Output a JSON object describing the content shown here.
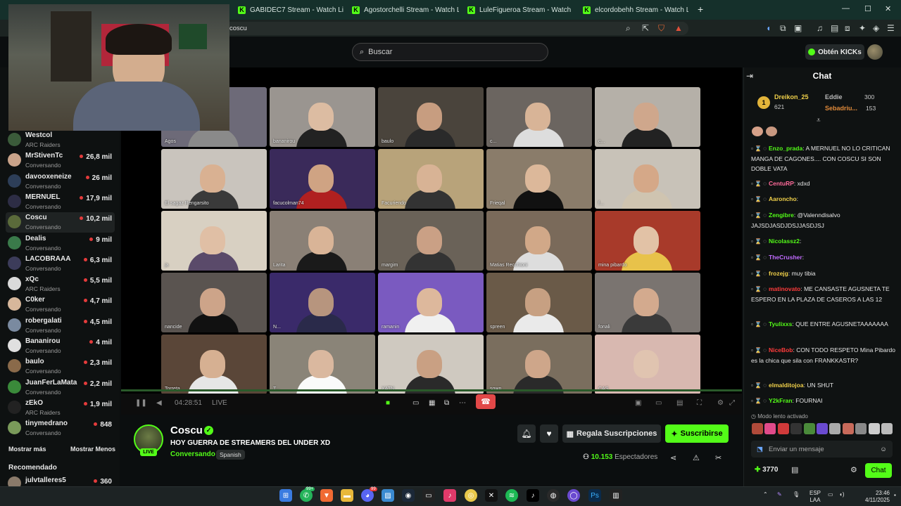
{
  "browser": {
    "tabs": [
      {
        "label": "GABIDEC7 Stream - Watch Live on Ki"
      },
      {
        "label": "Agostorchelli Stream - Watch Live on"
      },
      {
        "label": "LuleFigueroa Stream - Watch Live on"
      },
      {
        "label": "elcordobehh Stream - Watch Live on"
      }
    ],
    "new_tab": "+",
    "address": "coscu",
    "window_controls": {
      "minimize": "—",
      "maximize": "☐",
      "close": "✕"
    }
  },
  "header": {
    "search_placeholder": "Buscar",
    "kicks_button": "Obtén KICKs"
  },
  "sidebar": {
    "channels": [
      {
        "name": "Westcol",
        "status": "ARC Raiders",
        "viewers": "",
        "color": "#3b5b3a"
      },
      {
        "name": "MrStivenTc",
        "status": "Conversando",
        "viewers": "26,8 mil",
        "color": "#c9a38a"
      },
      {
        "name": "davooxeneize",
        "status": "Conversando",
        "viewers": "26 mil",
        "color": "#2d3e58"
      },
      {
        "name": "MERNUEL",
        "status": "Conversando",
        "viewers": "17,9 mil",
        "color": "#2d2d45"
      },
      {
        "name": "Coscu",
        "status": "Conversando",
        "viewers": "10,2 mil",
        "color": "#5a6a3a"
      },
      {
        "name": "Dealis",
        "status": "Conversando",
        "viewers": "9 mil",
        "color": "#3a7a4a"
      },
      {
        "name": "LACOBRAAA",
        "status": "Conversando",
        "viewers": "6,3 mil",
        "color": "#3c3c5a"
      },
      {
        "name": "xQc",
        "status": "ARC Raiders",
        "viewers": "5,5 mil",
        "color": "#dadada"
      },
      {
        "name": "C0ker",
        "status": "Conversando",
        "viewers": "4,7 mil",
        "color": "#d7b79b"
      },
      {
        "name": "robergalati",
        "status": "Conversando",
        "viewers": "4,5 mil",
        "color": "#7a8aa0"
      },
      {
        "name": "Bananirou",
        "status": "Conversando",
        "viewers": "4 mil",
        "color": "#e0e0e0"
      },
      {
        "name": "baulo",
        "status": "Conversando",
        "viewers": "2,3 mil",
        "color": "#8a6a4a"
      },
      {
        "name": "JuanFerLaMata",
        "status": "Conversando",
        "viewers": "2,2 mil",
        "color": "#3a8a3a"
      },
      {
        "name": "zEkO",
        "status": "ARC Raiders",
        "viewers": "1,9 mil",
        "color": "#222"
      },
      {
        "name": "tinymedrano",
        "status": "Conversando",
        "viewers": "848",
        "color": "#7a9a5a"
      }
    ],
    "show_more": "Mostrar más",
    "show_less": "Mostrar Menos",
    "recommended_title": "Recomendado",
    "recommended": [
      {
        "name": "julvtalleres5",
        "viewers": "360"
      }
    ]
  },
  "video": {
    "tiles": [
      {
        "label": "Agos",
        "bg": "#6d6a78",
        "skin": "#d6b49b",
        "shirt": "#8a8a8a"
      },
      {
        "label": "bananirou",
        "bg": "#9a9590",
        "skin": "#dcbca2",
        "shirt": "#222"
      },
      {
        "label": "baulo",
        "bg": "#4a443c",
        "skin": "#c79d80",
        "shirt": "#2a2a2a"
      },
      {
        "label": "c...",
        "bg": "#6b6560",
        "skin": "#d8b497",
        "shirt": "#ddd"
      },
      {
        "label": "c...",
        "bg": "#b5b0a8",
        "skin": "#cfa78c",
        "shirt": "#222"
      },
      {
        "label": "El sagaz Rengarsito",
        "bg": "#c9c4bd",
        "skin": "#d9b192",
        "shirt": "#3a3a3a"
      },
      {
        "label": "facucolman74",
        "bg": "#3a2a5a",
        "skin": "#cfa383",
        "shirt": "#b02020"
      },
      {
        "label": "Facuriendo",
        "bg": "#b8a37a",
        "skin": "#d8b395",
        "shirt": "#333"
      },
      {
        "label": "Frieqal",
        "bg": "#8a7c6a",
        "skin": "#dcb89a",
        "shirt": "#111"
      },
      {
        "label": "f...",
        "bg": "#c8c2b8",
        "skin": "#d5a888",
        "shirt": "#cfc4b0"
      },
      {
        "label": "ja",
        "bg": "#d8d0c2",
        "skin": "#e0bfa5",
        "shirt": "#5a4a6a"
      },
      {
        "label": "Larita",
        "bg": "#8a8076",
        "skin": "#d9b497",
        "shirt": "#1a1a1a"
      },
      {
        "label": "margim",
        "bg": "#6a6258",
        "skin": "#caa085",
        "shirt": "#333"
      },
      {
        "label": "Matias Recchioni",
        "bg": "#7a6a5a",
        "skin": "#d1a888",
        "shirt": "#ddd"
      },
      {
        "label": "mina pibardo",
        "bg": "#a83a2a",
        "skin": "#e2c2a6",
        "shirt": "#e8c24a"
      },
      {
        "label": "nancide",
        "bg": "#5a5450",
        "skin": "#cda489",
        "shirt": "#111"
      },
      {
        "label": "N...",
        "bg": "#3a2a6a",
        "skin": "#b7957e",
        "shirt": "#2a2a4a"
      },
      {
        "label": "ramanin",
        "bg": "#7a5ac0",
        "skin": "#ddb89c",
        "shirt": "#f0f0f0"
      },
      {
        "label": "spreen",
        "bg": "#6a5a48",
        "skin": "#c7a082",
        "shirt": "#eaeaea"
      },
      {
        "label": "fonali",
        "bg": "#7a7470",
        "skin": "#d3aa8e",
        "shirt": "#3a3a3a"
      },
      {
        "label": "Torreta",
        "bg": "#5a4638",
        "skin": "#d6b092",
        "shirt": "#e6e6e6"
      },
      {
        "label": "T...",
        "bg": "#8a8478",
        "skin": "#dab89f",
        "shirt": "#fafafa"
      },
      {
        "label": "XATN",
        "bg": "#cfc9c0",
        "skin": "#c9a083",
        "shirt": "#2a2a2a"
      },
      {
        "label": "sown",
        "bg": "#7a6e5e",
        "skin": "#cea68a",
        "shirt": "#2a2a2a"
      },
      {
        "label": "CAS",
        "bg": "#d8b8b0",
        "skin": "#e0c4b0",
        "shirt": "#d8b8b0"
      }
    ],
    "time": "04:28:51",
    "live": "LIVE"
  },
  "stream": {
    "name": "Coscu",
    "title": "HOY GUERRA DE STREAMERS DEL UNDER XD",
    "category": "Conversando",
    "language": "Spanish",
    "live_badge": "LIVE",
    "gift_button": "Regala Suscripciones",
    "subscribe_button": "Suscribirse",
    "viewers": "10.153",
    "viewers_label": "Espectadores"
  },
  "chat": {
    "title": "Chat",
    "leaderboard": [
      {
        "name": "Dreikon_25",
        "points": "621"
      },
      {
        "name": "Eddie",
        "points": "300"
      },
      {
        "name": "Sebadriu...",
        "points": "153"
      }
    ],
    "messages": [
      {
        "user": "Enzo_prada",
        "color": "#53fc18",
        "text": ": A MERNUEL NO LO CRITICAN MANGA DE CAGONES.... CON COSCU SI SON DOBLE VATA"
      },
      {
        "user": "CentuRP",
        "color": "#ff6b9a",
        "text": ": xdxd"
      },
      {
        "user": "Aaroncho",
        "color": "#f0d04a",
        "text": ":"
      },
      {
        "user": "Zengibre",
        "color": "#53fc18",
        "text": ": @Valenndisalvo JAJSDJASDJDSJJASDJSJ"
      },
      {
        "user": "Nicolassz2",
        "color": "#53fc18",
        "text": ":"
      },
      {
        "user": "TheCrusher",
        "color": "#c06bff",
        "text": ":"
      },
      {
        "user": "frozejg",
        "color": "#f0d04a",
        "text": ": muy tibia"
      },
      {
        "user": "matinovato",
        "color": "#ff3b3b",
        "text": ": ME CANSASTE AGUSNETA TE ESPERO EN LA PLAZA DE CASEROS A LAS 12"
      },
      {
        "user": "Tyulixxs",
        "color": "#53fc18",
        "text": ": QUE ENTRE AGUSNETAAAAAAA"
      },
      {
        "user": "NiceBob",
        "color": "#ff3b3b",
        "text": ": CON TODO RESPETO Mina Pibardo es la chica que sila con FRANKKASTR?"
      },
      {
        "user": "elmalditojoa",
        "color": "#f0d04a",
        "text": ": UN SHUT"
      },
      {
        "user": "Y2kFran",
        "color": "#53fc18",
        "text": ": FOURNAI"
      }
    ],
    "slow_mode": "Modo lento activado",
    "input_placeholder": "Enviar un mensaje",
    "points": "3770",
    "send_button": "Chat"
  },
  "taskbar": {
    "lang": "ESP",
    "lang2": "LAA",
    "time": "23:46",
    "date": "4/11/2025",
    "badge1": "99+",
    "badge2": "99"
  }
}
